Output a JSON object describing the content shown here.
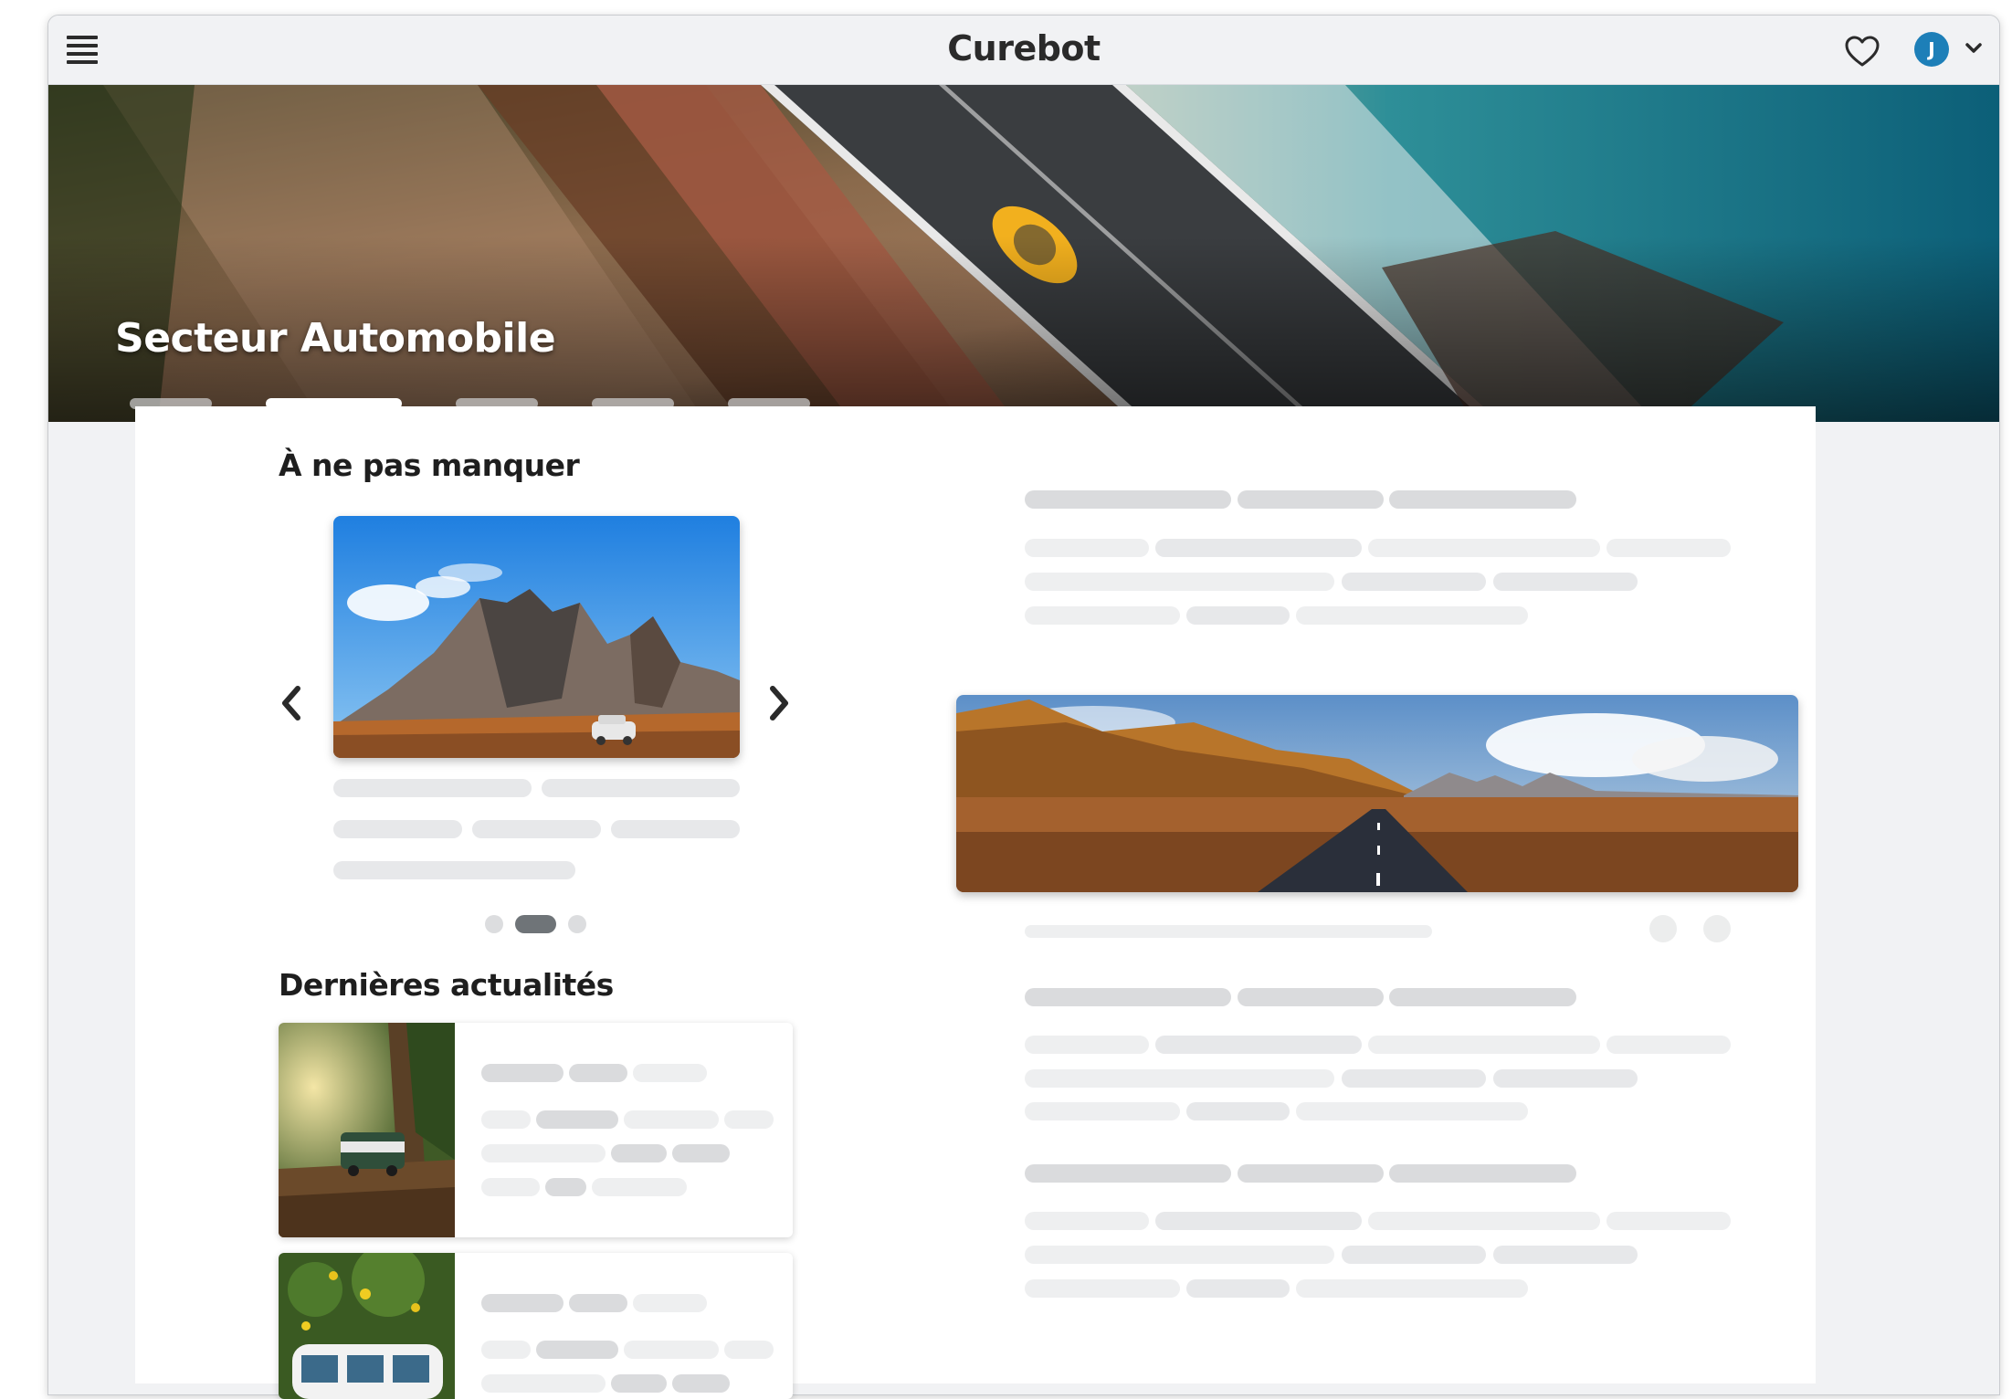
{
  "app": {
    "brand": "Curebot",
    "user_initial": "J"
  },
  "hero": {
    "title": "Secteur Automobile",
    "slides": 5,
    "active_slide": 2
  },
  "sections": {
    "must_see": "À ne pas manquer",
    "latest_news": "Dernières actualités"
  },
  "carousel": {
    "pages": 3,
    "active_page": 2
  },
  "icons": {
    "menu": "hamburger-menu-icon",
    "favorites": "heart-icon",
    "account_dropdown": "chevron-down-icon",
    "prev": "chevron-left-icon",
    "next": "chevron-right-icon"
  },
  "colors": {
    "avatar": "#1d7fb8",
    "background": "#f1f2f4",
    "skeleton": "#e7e8ea"
  }
}
